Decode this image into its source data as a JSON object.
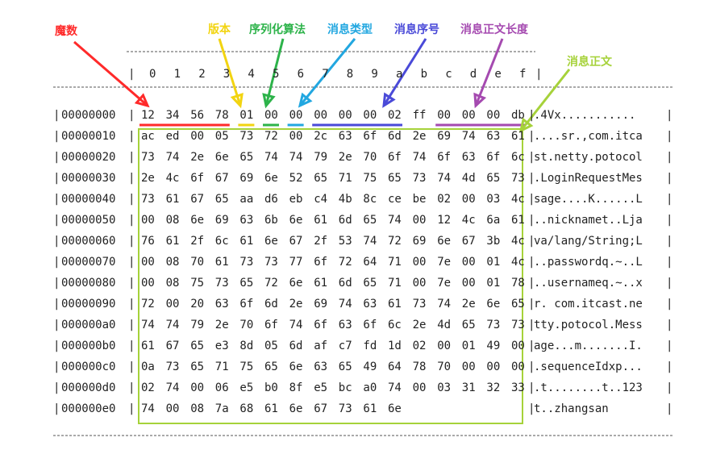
{
  "labels": {
    "magic": {
      "text": "魔数",
      "color": "#ff2a2a"
    },
    "version": {
      "text": "版本",
      "color": "#f2d411"
    },
    "serializer": {
      "text": "序列化算法",
      "color": "#2db34a"
    },
    "msgtype": {
      "text": "消息类型",
      "color": "#22a7e0"
    },
    "seq": {
      "text": "消息序号",
      "color": "#4a4ad8"
    },
    "length": {
      "text": "消息正文长度",
      "color": "#a54ab0"
    },
    "body": {
      "text": "消息正文",
      "color": "#a6d23a"
    }
  },
  "header_cols": [
    "0",
    "1",
    "2",
    "3",
    "4",
    "5",
    "6",
    "7",
    "8",
    "9",
    "a",
    "b",
    "c",
    "d",
    "e",
    "f"
  ],
  "rows": [
    {
      "offset": "00000000",
      "bytes": [
        "12",
        "34",
        "56",
        "78",
        "01",
        "00",
        "00",
        "00",
        "00",
        "00",
        "02",
        "ff",
        "00",
        "00",
        "00",
        "db"
      ],
      "ascii": ".4Vx..........."
    },
    {
      "offset": "00000010",
      "bytes": [
        "ac",
        "ed",
        "00",
        "05",
        "73",
        "72",
        "00",
        "2c",
        "63",
        "6f",
        "6d",
        "2e",
        "69",
        "74",
        "63",
        "61"
      ],
      "ascii": "....sr.,com.itca"
    },
    {
      "offset": "00000020",
      "bytes": [
        "73",
        "74",
        "2e",
        "6e",
        "65",
        "74",
        "74",
        "79",
        "2e",
        "70",
        "6f",
        "74",
        "6f",
        "63",
        "6f",
        "6c"
      ],
      "ascii": "st.netty.potocol"
    },
    {
      "offset": "00000030",
      "bytes": [
        "2e",
        "4c",
        "6f",
        "67",
        "69",
        "6e",
        "52",
        "65",
        "71",
        "75",
        "65",
        "73",
        "74",
        "4d",
        "65",
        "73"
      ],
      "ascii": ".LoginRequestMes"
    },
    {
      "offset": "00000040",
      "bytes": [
        "73",
        "61",
        "67",
        "65",
        "aa",
        "d6",
        "eb",
        "c4",
        "4b",
        "8c",
        "ce",
        "be",
        "02",
        "00",
        "03",
        "4c"
      ],
      "ascii": "sage....K......L"
    },
    {
      "offset": "00000050",
      "bytes": [
        "00",
        "08",
        "6e",
        "69",
        "63",
        "6b",
        "6e",
        "61",
        "6d",
        "65",
        "74",
        "00",
        "12",
        "4c",
        "6a",
        "61"
      ],
      "ascii": "..nicknamet..Lja"
    },
    {
      "offset": "00000060",
      "bytes": [
        "76",
        "61",
        "2f",
        "6c",
        "61",
        "6e",
        "67",
        "2f",
        "53",
        "74",
        "72",
        "69",
        "6e",
        "67",
        "3b",
        "4c"
      ],
      "ascii": "va/lang/String;L"
    },
    {
      "offset": "00000070",
      "bytes": [
        "00",
        "08",
        "70",
        "61",
        "73",
        "73",
        "77",
        "6f",
        "72",
        "64",
        "71",
        "00",
        "7e",
        "00",
        "01",
        "4c"
      ],
      "ascii": "..passwordq.~..L"
    },
    {
      "offset": "00000080",
      "bytes": [
        "00",
        "08",
        "75",
        "73",
        "65",
        "72",
        "6e",
        "61",
        "6d",
        "65",
        "71",
        "00",
        "7e",
        "00",
        "01",
        "78"
      ],
      "ascii": "..usernameq.~..x"
    },
    {
      "offset": "00000090",
      "bytes": [
        "72",
        "00",
        "20",
        "63",
        "6f",
        "6d",
        "2e",
        "69",
        "74",
        "63",
        "61",
        "73",
        "74",
        "2e",
        "6e",
        "65"
      ],
      "ascii": "r. com.itcast.ne"
    },
    {
      "offset": "000000a0",
      "bytes": [
        "74",
        "74",
        "79",
        "2e",
        "70",
        "6f",
        "74",
        "6f",
        "63",
        "6f",
        "6c",
        "2e",
        "4d",
        "65",
        "73",
        "73"
      ],
      "ascii": "tty.potocol.Mess"
    },
    {
      "offset": "000000b0",
      "bytes": [
        "61",
        "67",
        "65",
        "e3",
        "8d",
        "05",
        "6d",
        "af",
        "c7",
        "fd",
        "1d",
        "02",
        "00",
        "01",
        "49",
        "00"
      ],
      "ascii": "age...m.......I."
    },
    {
      "offset": "000000c0",
      "bytes": [
        "0a",
        "73",
        "65",
        "71",
        "75",
        "65",
        "6e",
        "63",
        "65",
        "49",
        "64",
        "78",
        "70",
        "00",
        "00",
        "00"
      ],
      "ascii": ".sequenceIdxp..."
    },
    {
      "offset": "000000d0",
      "bytes": [
        "02",
        "74",
        "00",
        "06",
        "e5",
        "b0",
        "8f",
        "e5",
        "bc",
        "a0",
        "74",
        "00",
        "03",
        "31",
        "32",
        "33"
      ],
      "ascii": ".t........t..123"
    },
    {
      "offset": "000000e0",
      "bytes": [
        "74",
        "00",
        "08",
        "7a",
        "68",
        "61",
        "6e",
        "67",
        "73",
        "61",
        "6e"
      ],
      "ascii": "t..zhangsan"
    }
  ],
  "dash_line": "+--------+-------------------------------------------------+----------------+"
}
